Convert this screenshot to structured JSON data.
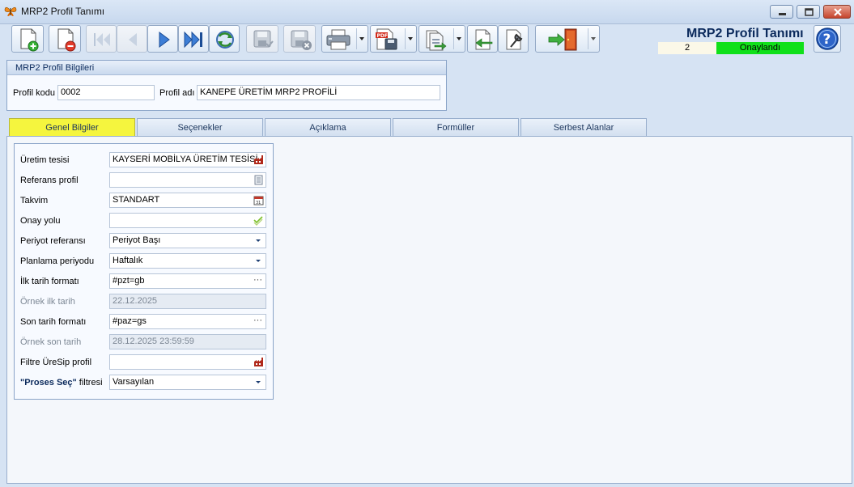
{
  "window": {
    "title": "MRP2 Profil Tanımı",
    "app_icon": "butterfly-icon"
  },
  "toolbar": {
    "icons": [
      "new-document-icon",
      "delete-document-icon",
      "first-record-icon",
      "previous-record-icon",
      "next-record-icon",
      "last-record-icon",
      "refresh-icon",
      "save-icon",
      "save-close-icon",
      "print-icon",
      "pdf-export-icon",
      "export-icon",
      "import-icon",
      "settings-icon",
      "exit-icon"
    ]
  },
  "header": {
    "title": "MRP2 Profil Tanımı",
    "record_number": "2",
    "status": "Onaylandı",
    "status_color": "#10e01a"
  },
  "profile_group": {
    "title": "MRP2 Profil Bilgileri",
    "code_label": "Profil kodu",
    "code_value": "0002",
    "name_label": "Profil adı",
    "name_value": "KANEPE ÜRETİM MRP2 PROFİLİ"
  },
  "tabs": [
    {
      "label": "Genel Bilgiler",
      "active": true
    },
    {
      "label": "Seçenekler",
      "active": false
    },
    {
      "label": "Açıklama",
      "active": false
    },
    {
      "label": "Formüller",
      "active": false
    },
    {
      "label": "Serbest Alanlar",
      "active": false
    }
  ],
  "form": {
    "uretim_tesisi": {
      "label": "Üretim tesisi",
      "value": "KAYSERİ MOBİLYA ÜRETİM TESİSİ",
      "icon": "factory-icon"
    },
    "referans_profil": {
      "label": "Referans profil",
      "value": "",
      "icon": "list-icon"
    },
    "takvim": {
      "label": "Takvim",
      "value": "STANDART",
      "icon": "calendar-icon"
    },
    "onay_yolu": {
      "label": "Onay yolu",
      "value": "",
      "icon": "checkmark-icon"
    },
    "periyot_referansi": {
      "label": "Periyot referansı",
      "value": "Periyot Başı"
    },
    "planlama_periyodu": {
      "label": "Planlama periyodu",
      "value": "Haftalık"
    },
    "ilk_tarih_formati": {
      "label": "İlk tarih formatı",
      "value": "#pzt=gb"
    },
    "ornek_ilk_tarih": {
      "label": "Örnek ilk tarih",
      "value": "22.12.2025"
    },
    "son_tarih_formati": {
      "label": "Son tarih formatı",
      "value": "#paz=gs"
    },
    "ornek_son_tarih": {
      "label": "Örnek son tarih",
      "value": "28.12.2025 23:59:59"
    },
    "filtre_uresip_profil": {
      "label": "Filtre ÜreSip profil",
      "value": "",
      "icon": "factory-icon"
    },
    "proses_sec_filtresi": {
      "label_bold": "\"Proses Seç\"",
      "label_rest": " filtresi",
      "value": "Varsayılan"
    }
  }
}
